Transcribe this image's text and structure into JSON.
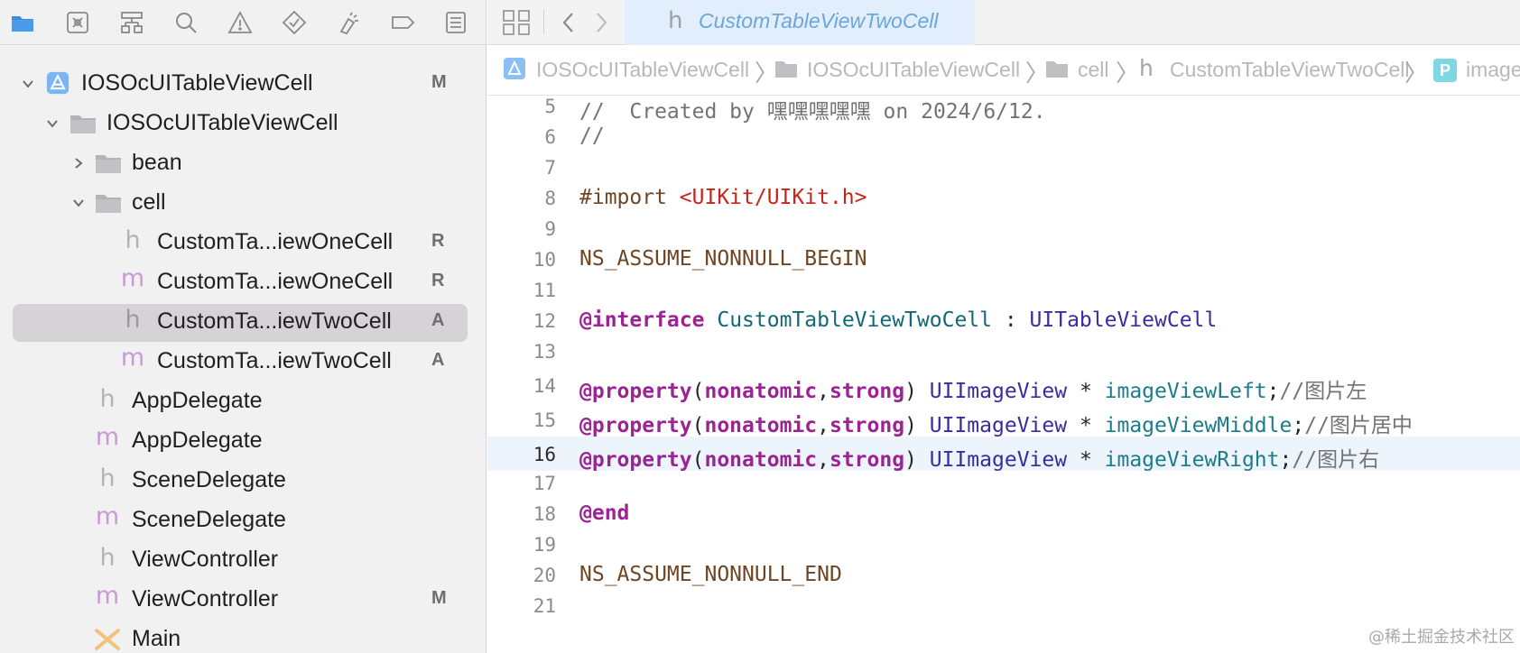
{
  "navigator": {
    "toolbar_icons": [
      "folder-icon",
      "source-control-icon",
      "symbol-icon",
      "search-icon",
      "warning-icon",
      "test-icon",
      "debug-icon",
      "breakpoint-icon",
      "report-icon"
    ],
    "tree": [
      {
        "label": "IOSOcUITableViewCell",
        "icon": "project-icon",
        "expanded": true,
        "badge": "M"
      },
      {
        "label": "IOSOcUITableViewCell",
        "icon": "folder-icon",
        "expanded": true,
        "badge": ""
      },
      {
        "label": "bean",
        "icon": "folder-icon",
        "expanded": false,
        "badge": ""
      },
      {
        "label": "cell",
        "icon": "folder-icon",
        "expanded": true,
        "badge": ""
      },
      {
        "label": "CustomTa...iewOneCell",
        "icon": "h",
        "badge": "R"
      },
      {
        "label": "CustomTa...iewOneCell",
        "icon": "m",
        "badge": "R"
      },
      {
        "label": "CustomTa...iewTwoCell",
        "icon": "h",
        "badge": "A",
        "selected": true
      },
      {
        "label": "CustomTa...iewTwoCell",
        "icon": "m",
        "badge": "A"
      },
      {
        "label": "AppDelegate",
        "icon": "h",
        "badge": ""
      },
      {
        "label": "AppDelegate",
        "icon": "m",
        "badge": ""
      },
      {
        "label": "SceneDelegate",
        "icon": "h",
        "badge": ""
      },
      {
        "label": "SceneDelegate",
        "icon": "m",
        "badge": ""
      },
      {
        "label": "ViewController",
        "icon": "h",
        "badge": ""
      },
      {
        "label": "ViewController",
        "icon": "m",
        "badge": "M"
      },
      {
        "label": "Main",
        "icon": "storyboard-icon",
        "badge": ""
      }
    ]
  },
  "editor": {
    "tab": {
      "icon": "h",
      "label": "CustomTableViewTwoCell"
    },
    "jumpbar": {
      "items": [
        "IOSOcUITableViewCell",
        "IOSOcUITableViewCell",
        "cell",
        "CustomTableViewTwoCell",
        "image"
      ],
      "last_icon_letter": "P"
    },
    "current_line": 16,
    "lines": [
      {
        "n": "5",
        "tokens": [
          {
            "t": "//  Created by 嘿嘿嘿嘿嘿 on 2024/6/12.",
            "c": "comment"
          }
        ]
      },
      {
        "n": "6",
        "tokens": [
          {
            "t": "//",
            "c": "comment"
          }
        ]
      },
      {
        "n": "7",
        "tokens": []
      },
      {
        "n": "8",
        "tokens": [
          {
            "t": "#import ",
            "c": "pp"
          },
          {
            "t": "<UIKit/UIKit.h>",
            "c": "str"
          }
        ]
      },
      {
        "n": "9",
        "tokens": []
      },
      {
        "n": "10",
        "tokens": [
          {
            "t": "NS_ASSUME_NONNULL_BEGIN",
            "c": "pp"
          }
        ]
      },
      {
        "n": "11",
        "tokens": []
      },
      {
        "n": "12",
        "tokens": [
          {
            "t": "@interface",
            "c": "kw"
          },
          {
            "t": " ",
            "c": "plain"
          },
          {
            "t": "CustomTableViewTwoCell",
            "c": "type"
          },
          {
            "t": " : ",
            "c": "plain"
          },
          {
            "t": "UITableViewCell",
            "c": "cls"
          }
        ]
      },
      {
        "n": "13",
        "tokens": []
      },
      {
        "n": "14",
        "tokens": [
          {
            "t": "@property",
            "c": "kw"
          },
          {
            "t": "(",
            "c": "plain"
          },
          {
            "t": "nonatomic",
            "c": "kw"
          },
          {
            "t": ",",
            "c": "plain"
          },
          {
            "t": "strong",
            "c": "kw"
          },
          {
            "t": ") ",
            "c": "plain"
          },
          {
            "t": "UIImageView",
            "c": "cls"
          },
          {
            "t": " * ",
            "c": "plain"
          },
          {
            "t": "imageViewLeft",
            "c": "prop"
          },
          {
            "t": ";",
            "c": "plain"
          },
          {
            "t": "//图片左",
            "c": "comment"
          }
        ]
      },
      {
        "n": "15",
        "tokens": [
          {
            "t": "@property",
            "c": "kw"
          },
          {
            "t": "(",
            "c": "plain"
          },
          {
            "t": "nonatomic",
            "c": "kw"
          },
          {
            "t": ",",
            "c": "plain"
          },
          {
            "t": "strong",
            "c": "kw"
          },
          {
            "t": ") ",
            "c": "plain"
          },
          {
            "t": "UIImageView",
            "c": "cls"
          },
          {
            "t": " * ",
            "c": "plain"
          },
          {
            "t": "imageViewMiddle",
            "c": "prop"
          },
          {
            "t": ";",
            "c": "plain"
          },
          {
            "t": "//图片居中",
            "c": "comment"
          }
        ]
      },
      {
        "n": "16",
        "tokens": [
          {
            "t": "@property",
            "c": "kw"
          },
          {
            "t": "(",
            "c": "plain"
          },
          {
            "t": "nonatomic",
            "c": "kw"
          },
          {
            "t": ",",
            "c": "plain"
          },
          {
            "t": "strong",
            "c": "kw"
          },
          {
            "t": ") ",
            "c": "plain"
          },
          {
            "t": "UIImageView",
            "c": "cls"
          },
          {
            "t": " * ",
            "c": "plain"
          },
          {
            "t": "imageViewRight",
            "c": "prop"
          },
          {
            "t": ";",
            "c": "plain"
          },
          {
            "t": "//图片右",
            "c": "comment"
          }
        ]
      },
      {
        "n": "17",
        "tokens": []
      },
      {
        "n": "18",
        "tokens": [
          {
            "t": "@end",
            "c": "kw"
          }
        ]
      },
      {
        "n": "19",
        "tokens": []
      },
      {
        "n": "20",
        "tokens": [
          {
            "t": "NS_ASSUME_NONNULL_END",
            "c": "pp"
          }
        ]
      },
      {
        "n": "21",
        "tokens": []
      }
    ]
  },
  "watermark": "@稀土掘金技术社区",
  "colors": {
    "selection": "#d5d3d5",
    "tab_active": "#e2eefb",
    "current_line": "#edf4fb",
    "accent": "#3b8fe0"
  }
}
